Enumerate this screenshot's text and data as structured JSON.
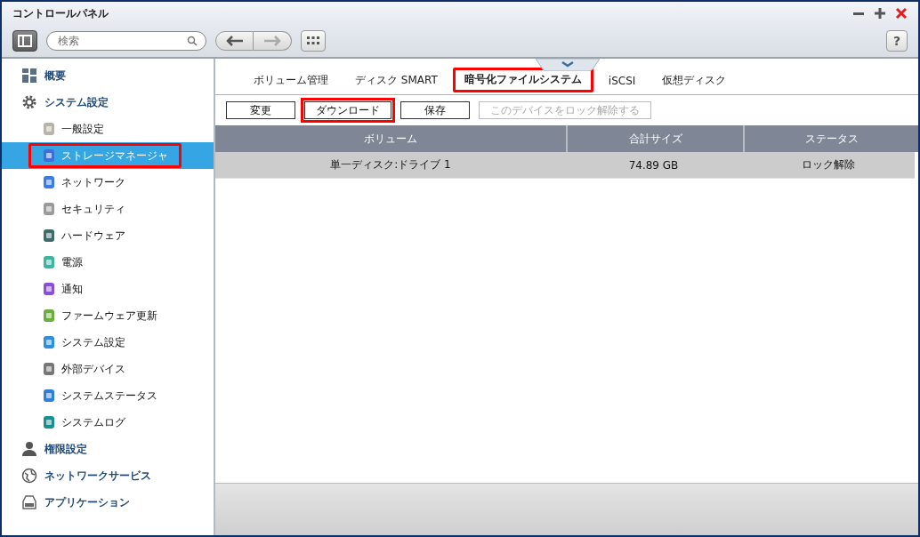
{
  "window": {
    "title": "コントロールパネル"
  },
  "toolbar": {
    "search": {
      "placeholder": "検索"
    }
  },
  "help": "?",
  "sidebar": {
    "sections": [
      {
        "label": "概要"
      },
      {
        "label": "システム設定",
        "children": [
          {
            "label": "一般設定",
            "selected": false,
            "highlighted": false
          },
          {
            "label": "ストレージマネージャ",
            "selected": true,
            "highlighted": true
          },
          {
            "label": "ネットワーク",
            "selected": false,
            "highlighted": false
          },
          {
            "label": "セキュリティ",
            "selected": false,
            "highlighted": false
          },
          {
            "label": "ハードウェア",
            "selected": false,
            "highlighted": false
          },
          {
            "label": "電源",
            "selected": false,
            "highlighted": false
          },
          {
            "label": "通知",
            "selected": false,
            "highlighted": false
          },
          {
            "label": "ファームウェア更新",
            "selected": false,
            "highlighted": false
          },
          {
            "label": "システム設定",
            "selected": false,
            "highlighted": false
          },
          {
            "label": "外部デバイス",
            "selected": false,
            "highlighted": false
          },
          {
            "label": "システムステータス",
            "selected": false,
            "highlighted": false
          },
          {
            "label": "システムログ",
            "selected": false,
            "highlighted": false
          }
        ]
      },
      {
        "label": "権限設定"
      },
      {
        "label": "ネットワークサービス"
      },
      {
        "label": "アプリケーション"
      }
    ]
  },
  "tabs": [
    {
      "label": "ボリューム管理",
      "selected": false,
      "highlighted": false
    },
    {
      "label": "ディスク SMART",
      "selected": false,
      "highlighted": false
    },
    {
      "label": "暗号化ファイルシステム",
      "selected": true,
      "highlighted": true
    },
    {
      "label": "iSCSI",
      "selected": false,
      "highlighted": false
    },
    {
      "label": "仮想ディスク",
      "selected": false,
      "highlighted": false
    }
  ],
  "buttons": [
    {
      "label": "変更",
      "disabled": false,
      "highlighted": false
    },
    {
      "label": "ダウンロード",
      "disabled": false,
      "highlighted": true
    },
    {
      "label": "保存",
      "disabled": false,
      "highlighted": false
    },
    {
      "label": "このデバイスをロック解除する",
      "disabled": true,
      "highlighted": false
    }
  ],
  "table": {
    "columns": [
      "ボリューム",
      "合計サイズ",
      "ステータス"
    ],
    "rows": [
      {
        "cells": [
          "単一ディスク:ドライブ 1",
          "74.89 GB",
          "ロック解除"
        ],
        "selected": true
      }
    ]
  }
}
